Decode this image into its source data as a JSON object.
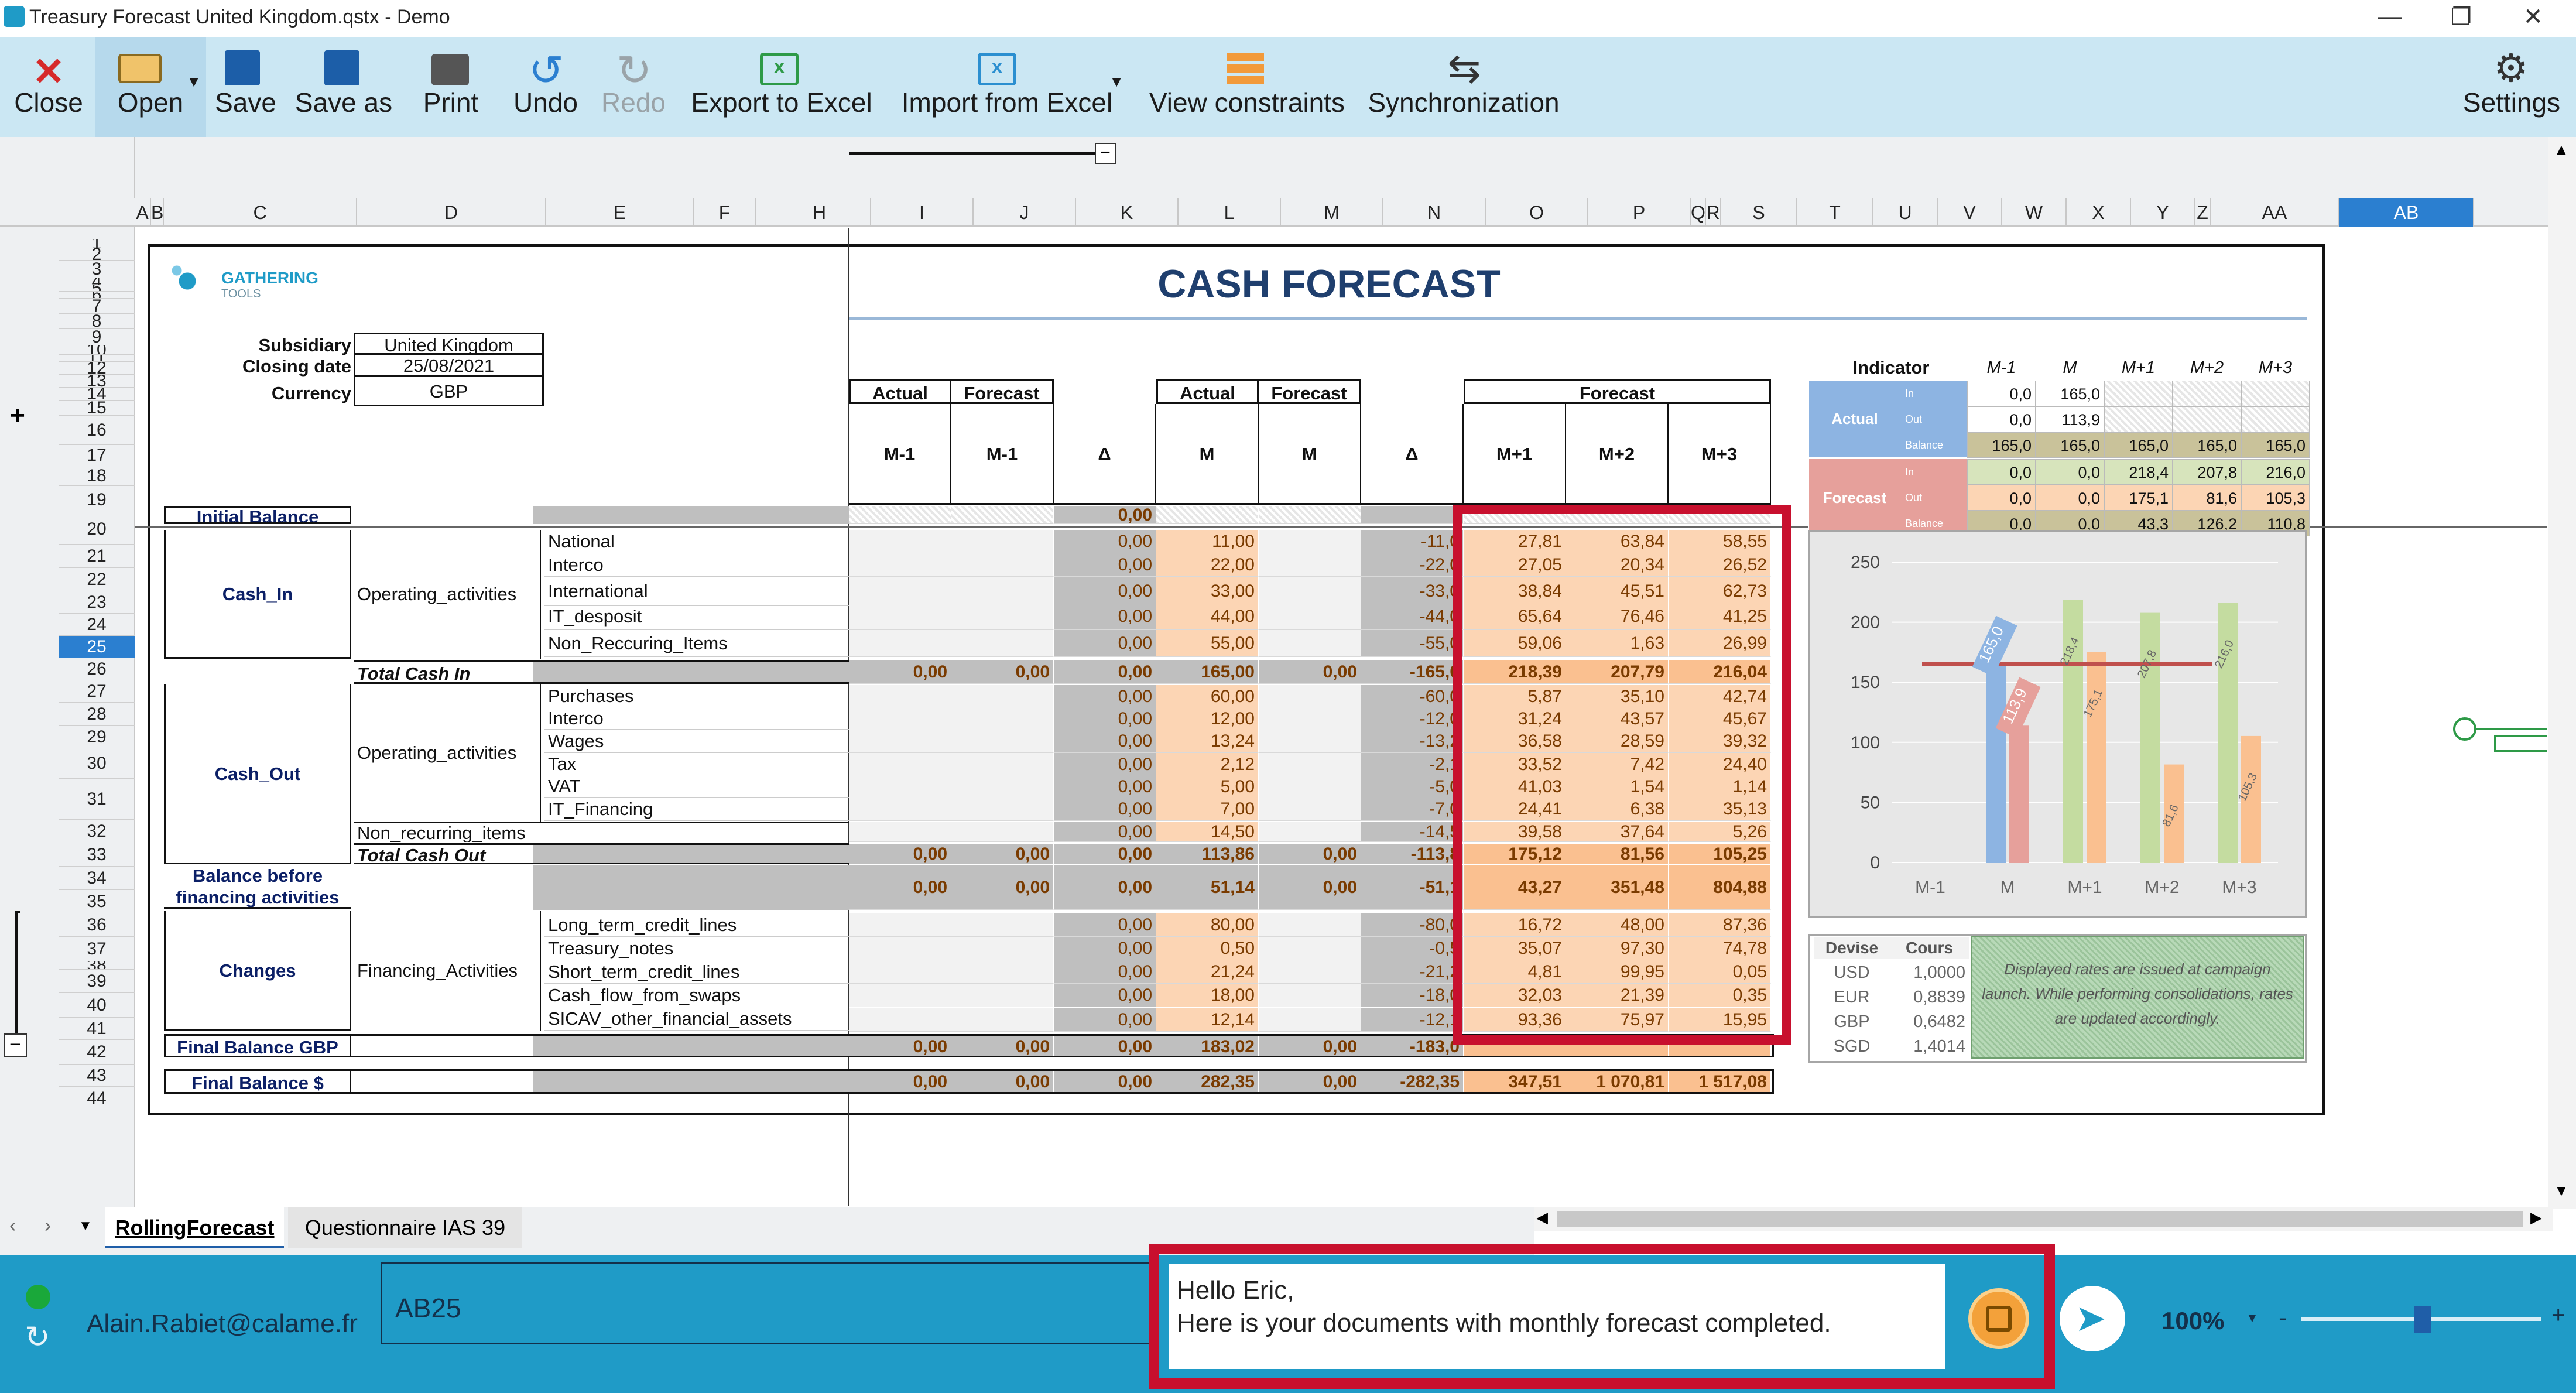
{
  "window": {
    "title": "Treasury Forecast United Kingdom.qstx - Demo"
  },
  "toolbar": {
    "close": "Close",
    "open": "Open",
    "save": "Save",
    "save_as": "Save as",
    "print": "Print",
    "undo": "Undo",
    "redo": "Redo",
    "export_excel": "Export to Excel",
    "import_excel": "Import from Excel",
    "view_constraints": "View constraints",
    "synchronization": "Synchronization",
    "settings": "Settings"
  },
  "grid": {
    "group_levels": [
      "1",
      "2"
    ],
    "outline_plus": "+",
    "outline_minus": "−",
    "collapse_btn": "−",
    "columns": [
      "A",
      "B",
      "C",
      "D",
      "E",
      "F",
      "H",
      "I",
      "J",
      "K",
      "L",
      "M",
      "N",
      "O",
      "P",
      "Q",
      "R",
      "S",
      "T",
      "U",
      "V",
      "W",
      "X",
      "Y",
      "Z",
      "AA",
      "AB"
    ],
    "rows": [
      "1",
      "2",
      "3",
      "4",
      "5",
      "6",
      "7",
      "8",
      "9",
      "10",
      "11",
      "12",
      "13",
      "14",
      "15",
      "16",
      "17",
      "18",
      "19",
      "20",
      "21",
      "22",
      "23",
      "24",
      "25",
      "26",
      "27",
      "28",
      "29",
      "30",
      "31",
      "32",
      "33",
      "34",
      "35",
      "36",
      "37",
      "38",
      "39",
      "40",
      "41",
      "42",
      "43",
      "44"
    ],
    "selected_row": "25",
    "selected_col": "AB"
  },
  "sheet": {
    "logo_text": "GATHERING",
    "logo_sub": "TOOLS",
    "title": "CASH FORECAST",
    "info": {
      "subsidiary_label": "Subsidiary",
      "subsidiary": "United Kingdom",
      "closing_label": "Closing date",
      "closing": "25/08/2021",
      "currency_label": "Currency",
      "currency": "GBP"
    },
    "headers": {
      "actual": "Actual",
      "forecast": "Forecast",
      "m1": "M-1",
      "delta": "Δ",
      "m": "M",
      "mp1": "M+1",
      "mp2": "M+2",
      "mp3": "M+3"
    },
    "labels": {
      "initial_balance": "Initial Balance",
      "cash_in": "Cash_In",
      "operating": "Operating_activities",
      "national": "National",
      "interco": "Interco",
      "international": "International",
      "it_deposit": "IT_desposit",
      "non_recurring": "Non_Reccuring_Items",
      "total_cash_in": "Total Cash In",
      "cash_out": "Cash_Out",
      "operating_out": "Operating_activities",
      "purchases": "Purchases",
      "interco2": "Interco",
      "wages": "Wages",
      "tax": "Tax",
      "vat": "VAT",
      "it_financing": "IT_Financing",
      "non_recurring2": "Non_recurring_items",
      "total_cash_out": "Total Cash Out",
      "bbf1": "Balance before",
      "bbf2": "financing activities",
      "changes": "Changes",
      "financing": "Financing_Activities",
      "ltcl": "Long_term_credit_lines",
      "tn": "Treasury_notes",
      "stcl": "Short_term_credit_lines",
      "cffs": "Cash_flow_from_swaps",
      "sicav": "SICAV_other_financial_assets",
      "final_gbp": "Final Balance GBP",
      "final_usd": "Final Balance $"
    },
    "rows": [
      {
        "k": "initial",
        "v": [
          "",
          "",
          "0,00",
          "",
          "",
          "",
          "",
          "",
          ""
        ]
      },
      {
        "k": "national",
        "v": [
          "",
          "",
          "0,00",
          "11,00",
          "",
          "-11,0",
          "27,81",
          "63,84",
          "58,55"
        ]
      },
      {
        "k": "interco",
        "v": [
          "",
          "",
          "0,00",
          "22,00",
          "",
          "-22,0",
          "27,05",
          "20,34",
          "26,52"
        ]
      },
      {
        "k": "international",
        "v": [
          "",
          "",
          "0,00",
          "33,00",
          "",
          "-33,0",
          "38,84",
          "45,51",
          "62,73"
        ]
      },
      {
        "k": "it_deposit",
        "v": [
          "",
          "",
          "0,00",
          "44,00",
          "",
          "-44,0",
          "65,64",
          "76,46",
          "41,25"
        ]
      },
      {
        "k": "non_recurring",
        "v": [
          "",
          "",
          "0,00",
          "55,00",
          "",
          "-55,0",
          "59,06",
          "1,63",
          "26,99"
        ]
      },
      {
        "k": "total_in",
        "v": [
          "0,00",
          "0,00",
          "0,00",
          "165,00",
          "0,00",
          "-165,0",
          "218,39",
          "207,79",
          "216,04"
        ]
      },
      {
        "k": "purchases",
        "v": [
          "",
          "",
          "0,00",
          "60,00",
          "",
          "-60,0",
          "5,87",
          "35,10",
          "42,74"
        ]
      },
      {
        "k": "interco2",
        "v": [
          "",
          "",
          "0,00",
          "12,00",
          "",
          "-12,0",
          "31,24",
          "43,57",
          "45,67"
        ]
      },
      {
        "k": "wages",
        "v": [
          "",
          "",
          "0,00",
          "13,24",
          "",
          "-13,2",
          "36,58",
          "28,59",
          "39,32"
        ]
      },
      {
        "k": "tax",
        "v": [
          "",
          "",
          "0,00",
          "2,12",
          "",
          "-2,1",
          "33,52",
          "7,42",
          "24,40"
        ]
      },
      {
        "k": "vat",
        "v": [
          "",
          "",
          "0,00",
          "5,00",
          "",
          "-5,0",
          "41,03",
          "1,54",
          "1,14"
        ]
      },
      {
        "k": "it_fin",
        "v": [
          "",
          "",
          "0,00",
          "7,00",
          "",
          "-7,0",
          "24,41",
          "6,38",
          "35,13"
        ]
      },
      {
        "k": "non_rec2",
        "v": [
          "",
          "",
          "0,00",
          "14,50",
          "",
          "-14,5",
          "39,58",
          "37,64",
          "5,26"
        ]
      },
      {
        "k": "total_out",
        "v": [
          "0,00",
          "0,00",
          "0,00",
          "113,86",
          "0,00",
          "-113,8",
          "175,12",
          "81,56",
          "105,25"
        ]
      },
      {
        "k": "bbf",
        "v": [
          "0,00",
          "0,00",
          "0,00",
          "51,14",
          "0,00",
          "-51,1",
          "43,27",
          "351,48",
          "804,88"
        ]
      },
      {
        "k": "ltcl",
        "v": [
          "",
          "",
          "0,00",
          "80,00",
          "",
          "-80,0",
          "16,72",
          "48,00",
          "87,36"
        ]
      },
      {
        "k": "tn",
        "v": [
          "",
          "",
          "0,00",
          "0,50",
          "",
          "-0,5",
          "35,07",
          "97,30",
          "74,78"
        ]
      },
      {
        "k": "stcl",
        "v": [
          "",
          "",
          "0,00",
          "21,24",
          "",
          "-21,2",
          "4,81",
          "99,95",
          "0,05"
        ]
      },
      {
        "k": "cffs",
        "v": [
          "",
          "",
          "0,00",
          "18,00",
          "",
          "-18,0",
          "32,03",
          "21,39",
          "0,35"
        ]
      },
      {
        "k": "sicav",
        "v": [
          "",
          "",
          "0,00",
          "12,14",
          "",
          "-12,1",
          "93,36",
          "75,97",
          "15,95"
        ]
      },
      {
        "k": "final_gbp",
        "v": [
          "0,00",
          "0,00",
          "0,00",
          "183,02",
          "0,00",
          "-183,0",
          "",
          "",
          ""
        ]
      },
      {
        "k": "final_usd",
        "v": [
          "0,00",
          "0,00",
          "0,00",
          "282,35",
          "0,00",
          "-282,35",
          "347,51",
          "1 070,81",
          "1 517,08"
        ]
      }
    ],
    "indicator": {
      "title": "Indicator",
      "cols": [
        "M-1",
        "M",
        "M+1",
        "M+2",
        "M+3"
      ],
      "actual": "Actual",
      "forecast": "Forecast",
      "in": "In",
      "out": "Out",
      "balance": "Balance",
      "actual_rows": [
        [
          "0,0",
          "165,0",
          "",
          "",
          ""
        ],
        [
          "0,0",
          "113,9",
          "",
          "",
          ""
        ],
        [
          "165,0",
          "165,0",
          "165,0",
          "165,0",
          "165,0"
        ]
      ],
      "forecast_rows": [
        [
          "0,0",
          "0,0",
          "218,4",
          "207,8",
          "216,0"
        ],
        [
          "0,0",
          "0,0",
          "175,1",
          "81,6",
          "105,3"
        ],
        [
          "0,0",
          "0,0",
          "43,3",
          "126,2",
          "110,8"
        ]
      ]
    },
    "rates": {
      "head_devise": "Devise",
      "head_cours": "Cours",
      "rows": [
        [
          "USD",
          "1,0000"
        ],
        [
          "EUR",
          "0,8839"
        ],
        [
          "GBP",
          "0,6482"
        ],
        [
          "SGD",
          "1,4014"
        ]
      ],
      "note": "Displayed rates are issued at campaign launch. While performing consolidations, rates are updated accordingly."
    }
  },
  "chart_data": {
    "type": "bar",
    "categories": [
      "M-1",
      "M",
      "M+1",
      "M+2",
      "M+3"
    ],
    "series": [
      {
        "values": [
          0,
          165.0,
          0,
          0,
          0
        ]
      },
      {
        "values": [
          0,
          113.9,
          0,
          0,
          0
        ]
      },
      {
        "values": [
          0,
          0,
          218.4,
          207.8,
          216.0
        ]
      },
      {
        "values": [
          0,
          0,
          175.1,
          81.6,
          105.3
        ]
      }
    ],
    "reference_line": 165.0,
    "ylim": [
      0,
      250
    ],
    "yticks": [
      0,
      50,
      100,
      150,
      200,
      250
    ],
    "data_labels": [
      "165,0",
      "113,9",
      "218,4",
      "175,1",
      "207,8",
      "81,6",
      "216,0",
      "105,3"
    ],
    "colors": {
      "actual_in": "#8db4e2",
      "actual_out": "#e6a09b",
      "forecast_in": "#c4dca0",
      "forecast_out": "#fac090",
      "line": "#c0504d"
    }
  },
  "tabs": {
    "t1": "RollingForecast",
    "t2": "Questionnaire IAS 39"
  },
  "bottom": {
    "user": "Alain.Rabiet@calame.fr",
    "cell_ref": "AB25",
    "message_line1": "Hello Eric,",
    "message_line2": "Here is your documents with monthly forecast completed.",
    "zoom": "100%"
  }
}
